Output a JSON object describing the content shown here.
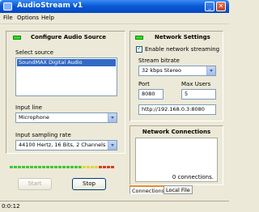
{
  "window": {
    "title": "AudioStream   v1"
  },
  "menu": [
    "File",
    "Options",
    "Help"
  ],
  "audio_source": {
    "title": "Configure Audio Source",
    "select_source_label": "Select source",
    "selected_source": "SoundMAX Digital Audio",
    "input_line_label": "Input line",
    "input_line_value": "Microphone",
    "sampling_rate_label": "Input sampling rate",
    "sampling_rate_value": "44100 Hertz, 16 Bits, 2 Channels",
    "start_label": "Start",
    "stop_label": "Stop"
  },
  "network": {
    "title": "Network Settings",
    "enable_label": "Enable network streaming",
    "bitrate_label": "Stream bitrate",
    "bitrate_value": "32 kbps Stereo",
    "port_label": "Port",
    "port_value": "8080",
    "max_users_label": "Max Users",
    "max_users_value": "5",
    "url_value": "http://192.168.0.3:8080"
  },
  "connections": {
    "title": "Network Connections",
    "count_text": "0 connections.",
    "tabs": [
      "Connections",
      "Local File"
    ]
  },
  "status": {
    "time": "0:0:12"
  },
  "colors": {
    "led": "#27e01e",
    "selection": "#316ac5",
    "titlebar": "#0a5ad6"
  }
}
